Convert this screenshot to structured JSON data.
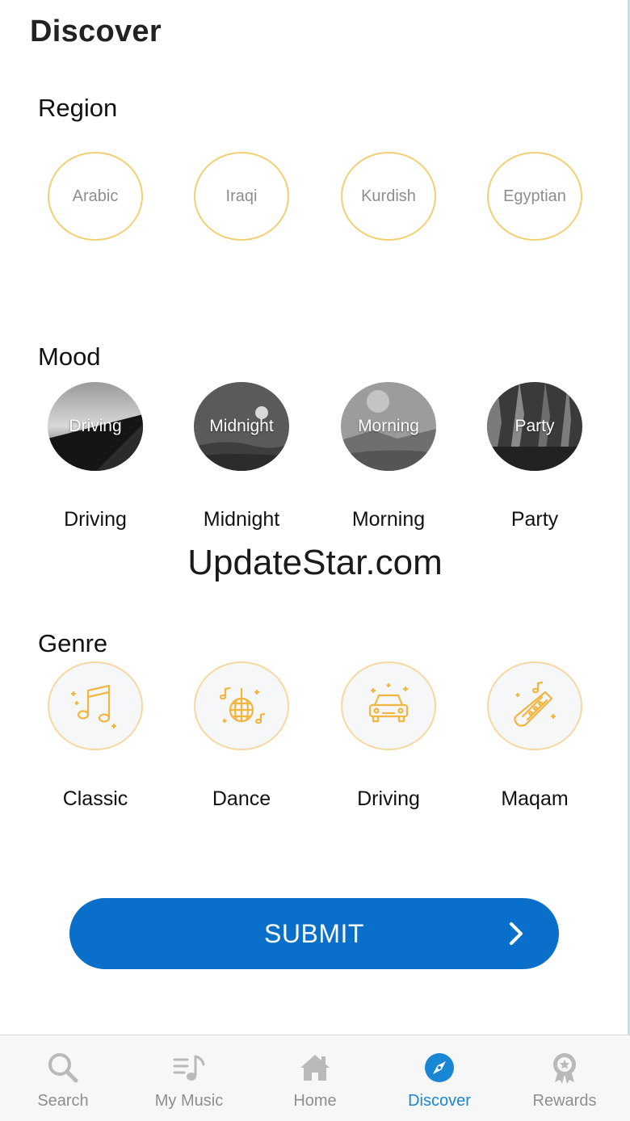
{
  "header": {
    "title": "Discover"
  },
  "region": {
    "title": "Region",
    "items": [
      {
        "label": "Arabic"
      },
      {
        "label": "Iraqi"
      },
      {
        "label": "Kurdish"
      },
      {
        "label": "Egyptian"
      }
    ]
  },
  "mood": {
    "title": "Mood",
    "items": [
      {
        "overlay": "Driving",
        "label": "Driving"
      },
      {
        "overlay": "Midnight",
        "label": "Midnight"
      },
      {
        "overlay": "Morning",
        "label": "Morning"
      },
      {
        "overlay": "Party",
        "label": "Party"
      }
    ]
  },
  "watermark": "UpdateStar.com",
  "genre": {
    "title": "Genre",
    "items": [
      {
        "label": "Classic",
        "icon": "music-notes-icon"
      },
      {
        "label": "Dance",
        "icon": "disco-ball-icon"
      },
      {
        "label": "Driving",
        "icon": "car-icon"
      },
      {
        "label": "Maqam",
        "icon": "saxophone-icon"
      }
    ]
  },
  "submit": {
    "label": "SUBMIT"
  },
  "tabbar": {
    "tabs": [
      {
        "label": "Search",
        "icon": "search-icon"
      },
      {
        "label": "My Music",
        "icon": "playlist-icon"
      },
      {
        "label": "Home",
        "icon": "home-icon"
      },
      {
        "label": "Discover",
        "icon": "compass-icon",
        "active": true
      },
      {
        "label": "Rewards",
        "icon": "award-icon"
      }
    ]
  },
  "colors": {
    "accent": "#0a6ecb",
    "active_tab": "#1a86d6",
    "gold": "#f2cf72",
    "inactive": "#8e8e8e"
  }
}
